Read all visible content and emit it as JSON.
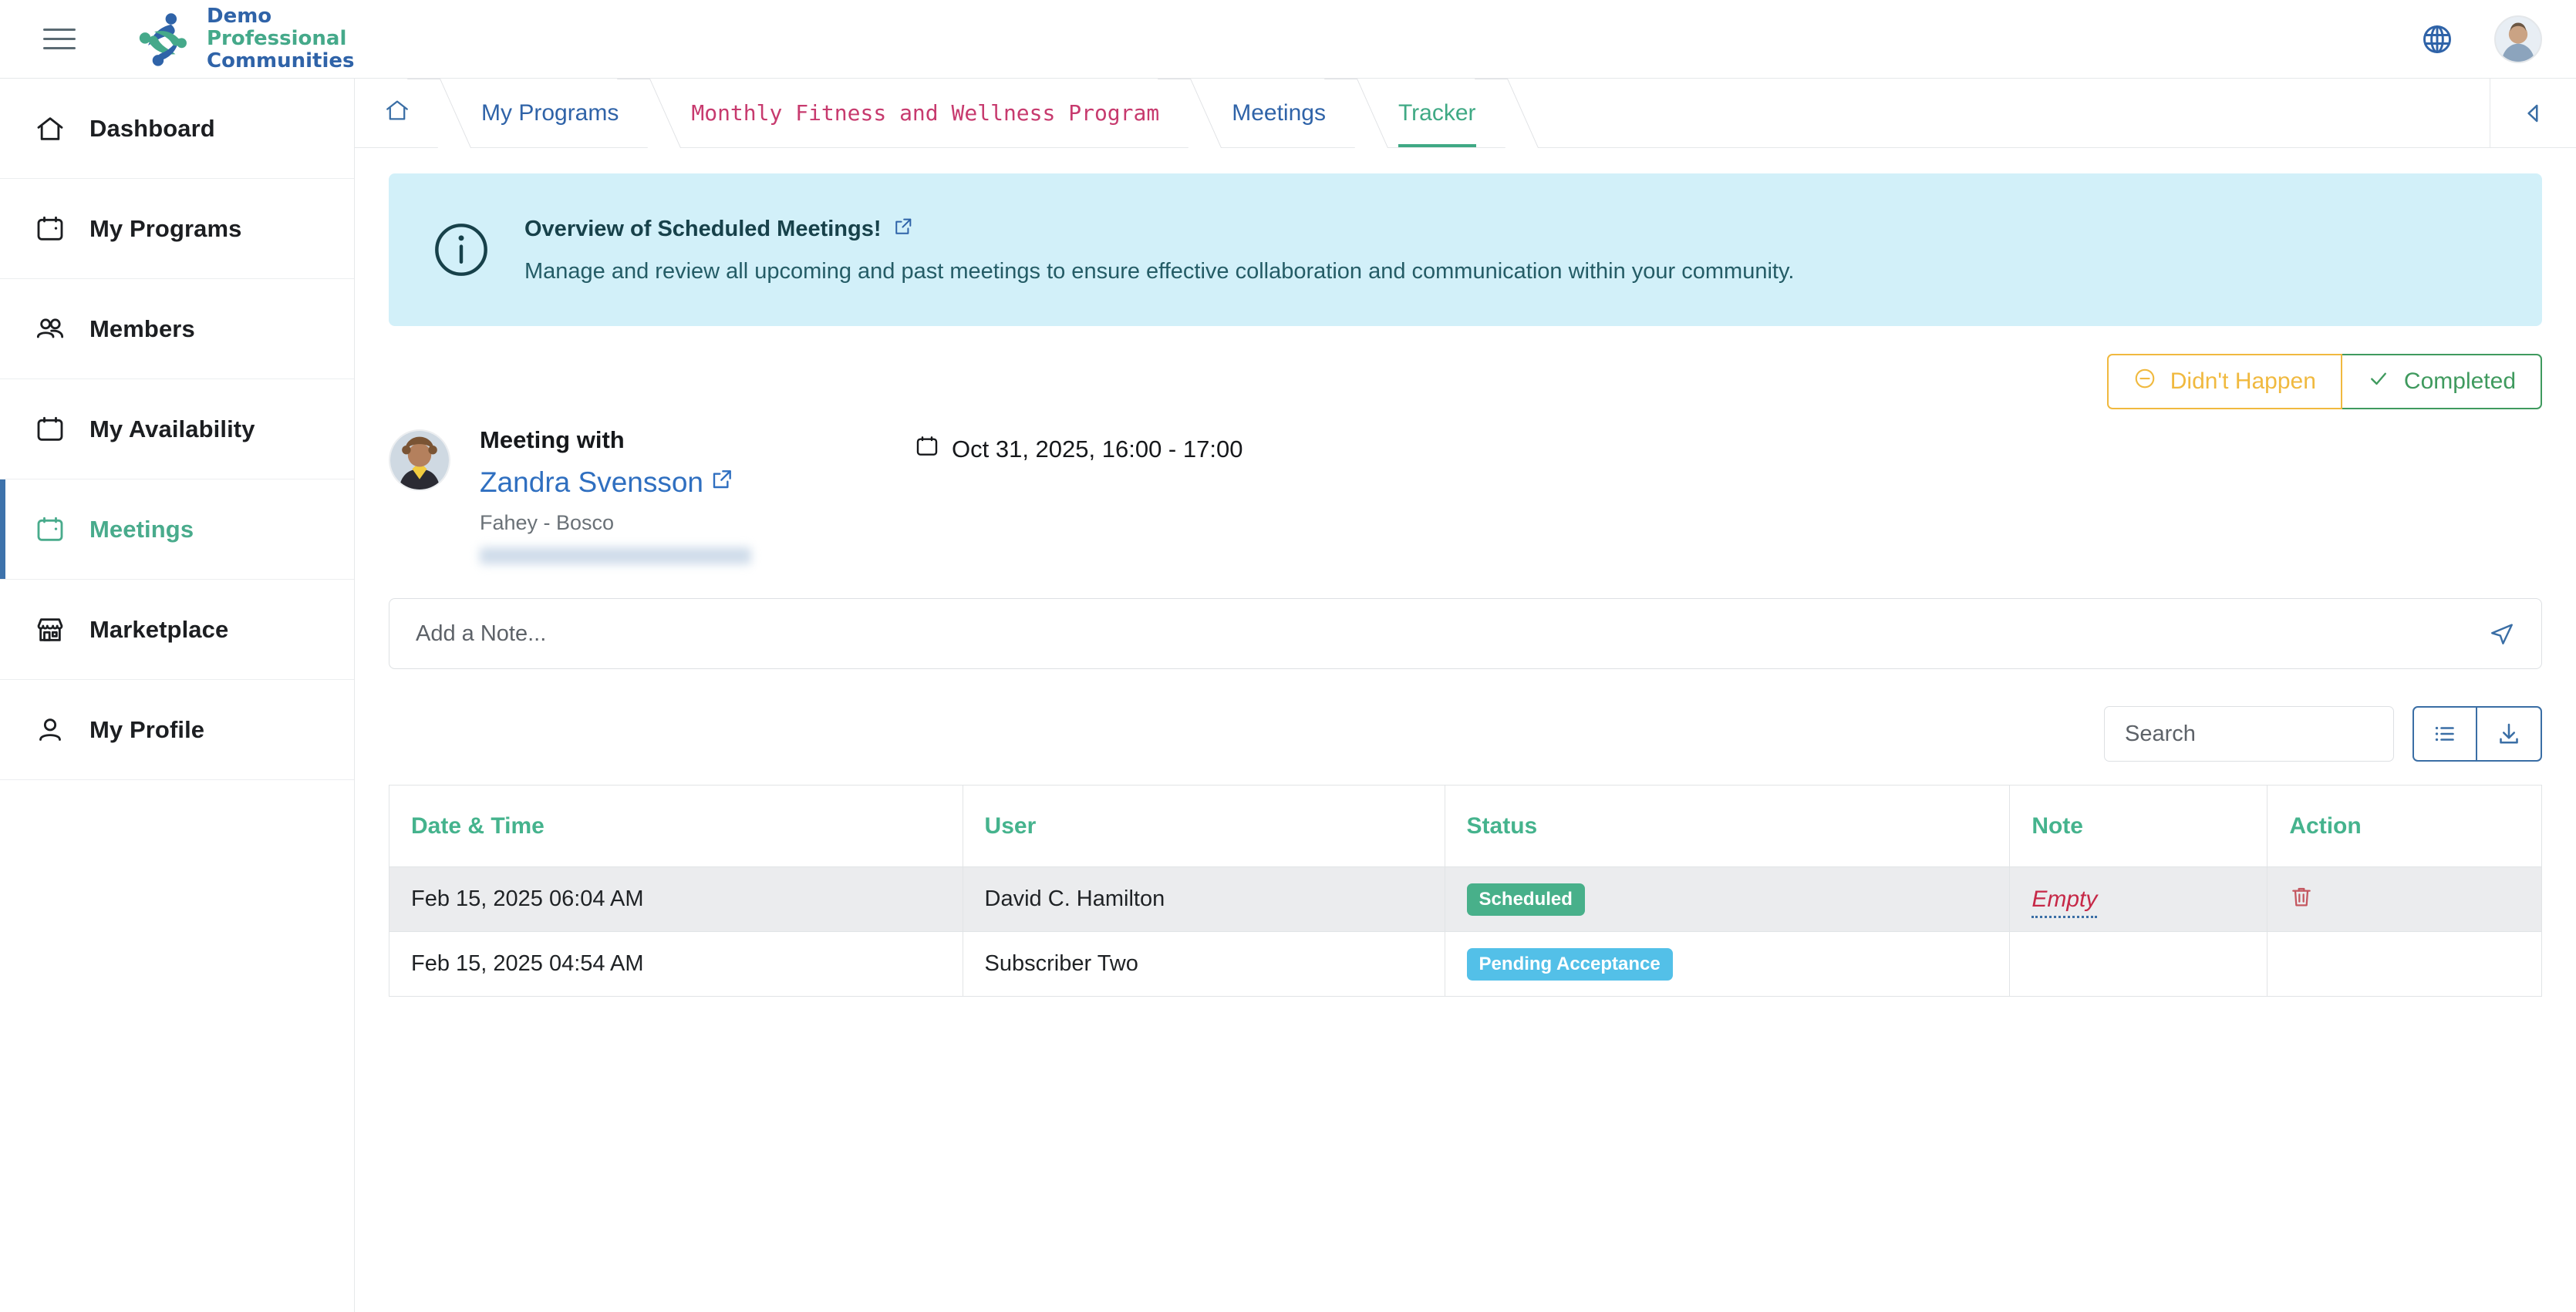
{
  "topbar": {
    "menu_icon": "hamburger-icon",
    "brand": {
      "line1": "Demo",
      "line2": "Professional",
      "line3": "Communities"
    },
    "language_icon": "globe-icon",
    "avatar_icon": "user-avatar"
  },
  "sidebar": {
    "items": [
      {
        "label": "Dashboard",
        "icon": "home-icon",
        "active": false
      },
      {
        "label": "My Programs",
        "icon": "calendar-icon",
        "active": false
      },
      {
        "label": "Members",
        "icon": "users-icon",
        "active": false
      },
      {
        "label": "My Availability",
        "icon": "calendar-icon",
        "active": false
      },
      {
        "label": "Meetings",
        "icon": "calendar-icon",
        "active": true
      },
      {
        "label": "Marketplace",
        "icon": "storefront-icon",
        "active": false
      },
      {
        "label": "My Profile",
        "icon": "person-icon",
        "active": false
      }
    ]
  },
  "breadcrumb": {
    "home_icon": "home-icon",
    "items": [
      {
        "label": "My Programs"
      },
      {
        "label": "Monthly Fitness and Wellness Program"
      },
      {
        "label": "Meetings"
      },
      {
        "label": "Tracker"
      }
    ],
    "collapse_icon": "caret-left-icon",
    "colors": {
      "link": "#2f63a8",
      "program": "#c73a6e",
      "current": "#3fa984"
    }
  },
  "banner": {
    "icon": "info-circle-icon",
    "title": "Overview of Scheduled Meetings!",
    "title_link_icon": "external-link-icon",
    "description": "Manage and review all upcoming and past meetings to ensure effective collaboration and communication within your community.",
    "background": "#d2f0f9"
  },
  "status_actions": {
    "didnt_happen": {
      "label": "Didn't Happen",
      "icon": "minus-circle-icon",
      "color": "#f0b93f"
    },
    "completed": {
      "label": "Completed",
      "icon": "check-icon",
      "color": "#3f9a5e"
    }
  },
  "meeting": {
    "avatar": "participant-avatar",
    "label": "Meeting with",
    "participant": "Zandra Svensson",
    "participant_link_icon": "external-link-icon",
    "organization": "Fahey - Bosco",
    "redacted_line": "",
    "calendar_icon": "calendar-icon",
    "datetime": "Oct 31, 2025, 16:00 - 17:00"
  },
  "note": {
    "placeholder": "Add a Note...",
    "value": "",
    "send_icon": "send-icon"
  },
  "toolbar": {
    "search_placeholder": "Search",
    "search_value": "",
    "list_view_icon": "list-icon",
    "download_icon": "download-icon"
  },
  "table": {
    "columns": [
      "Date & Time",
      "User",
      "Status",
      "Note",
      "Action"
    ],
    "rows": [
      {
        "datetime": "Feb 15, 2025 06:04 AM",
        "user": "David C. Hamilton",
        "status": "Scheduled",
        "status_style": "scheduled",
        "note": "Empty",
        "action_icon": "trash-icon",
        "has_action": true
      },
      {
        "datetime": "Feb 15, 2025 04:54 AM",
        "user": "Subscriber Two",
        "status": "Pending Acceptance",
        "status_style": "pending",
        "note": "",
        "action_icon": "",
        "has_action": false
      }
    ],
    "colors": {
      "header": "#45b38d",
      "scheduled_badge": "#48b08a",
      "pending_badge": "#53c0e8",
      "note_empty": "#c62847",
      "trash": "#c4565f"
    }
  }
}
